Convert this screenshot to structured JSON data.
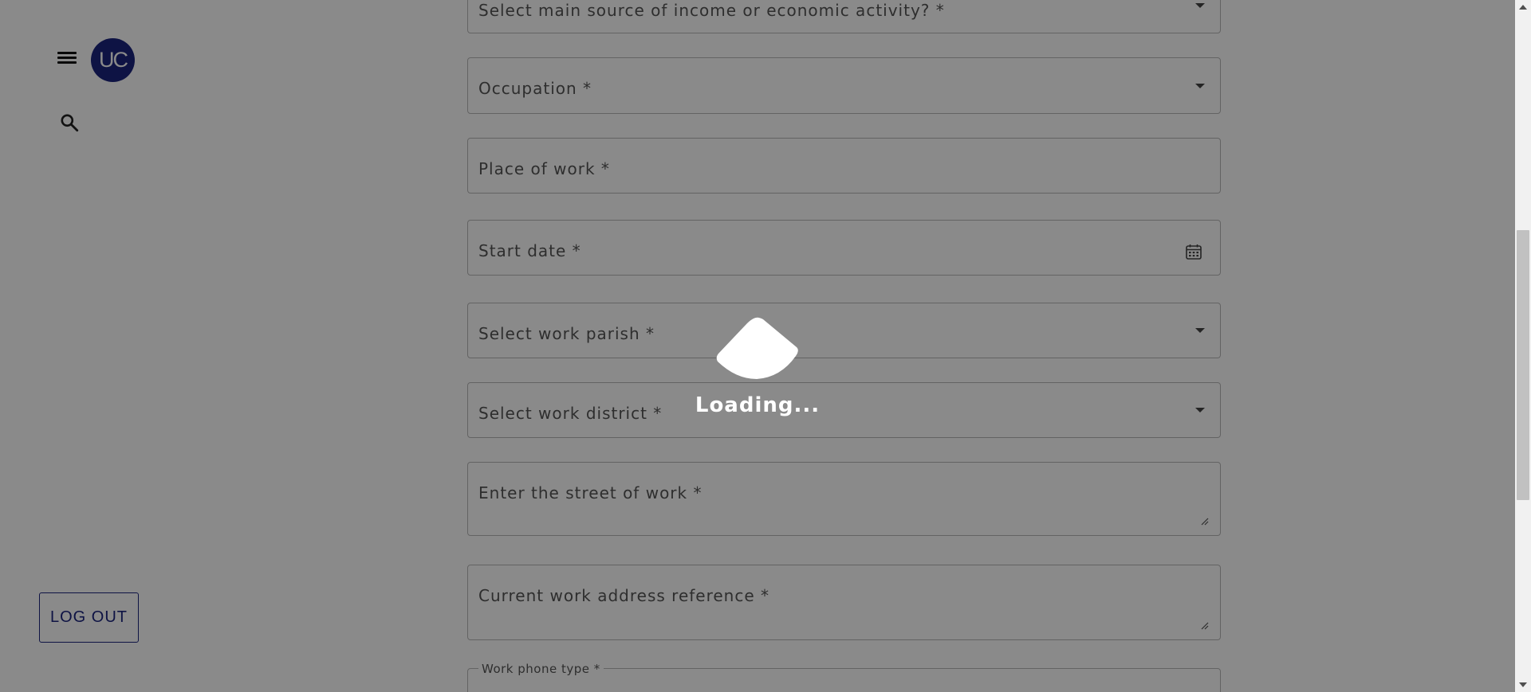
{
  "sidebar": {
    "avatar_initials": "UC",
    "logout_label": "LOG OUT"
  },
  "form": {
    "income_source": "Select main source of income or economic activity? *",
    "occupation": "Occupation *",
    "place_of_work": "Place of work *",
    "start_date": "Start date *",
    "work_parish": "Select work parish *",
    "work_district": "Select work district *",
    "street_of_work": "Enter the street of work *",
    "address_reference": "Current work address reference *",
    "phone_type_label": "Work phone type *"
  },
  "overlay": {
    "loading_text": "Loading..."
  },
  "colors": {
    "accent": "#1a237e",
    "overlay": "rgba(0,0,0,0.46)"
  }
}
